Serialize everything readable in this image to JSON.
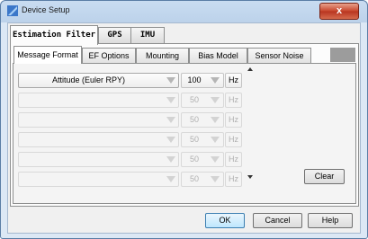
{
  "window": {
    "title": "Device Setup",
    "close_glyph": "x"
  },
  "outer_tabs": [
    "Estimation Filter",
    "GPS",
    "IMU"
  ],
  "inner_tabs": [
    "Message Format",
    "EF Options",
    "Mounting",
    "Bias Model",
    "Sensor Noise"
  ],
  "rows": [
    {
      "format": "Attitude (Euler RPY)",
      "rate": "100",
      "unit": "Hz",
      "enabled": true
    },
    {
      "format": "",
      "rate": "50",
      "unit": "Hz",
      "enabled": false
    },
    {
      "format": "",
      "rate": "50",
      "unit": "Hz",
      "enabled": false
    },
    {
      "format": "",
      "rate": "50",
      "unit": "Hz",
      "enabled": false
    },
    {
      "format": "",
      "rate": "50",
      "unit": "Hz",
      "enabled": false
    },
    {
      "format": "",
      "rate": "50",
      "unit": "Hz",
      "enabled": false
    }
  ],
  "buttons": {
    "clear": "Clear",
    "ok": "OK",
    "cancel": "Cancel",
    "help": "Help"
  },
  "colors": {
    "close_button": "#c7442b",
    "title_bar": "#c9dcf1"
  }
}
